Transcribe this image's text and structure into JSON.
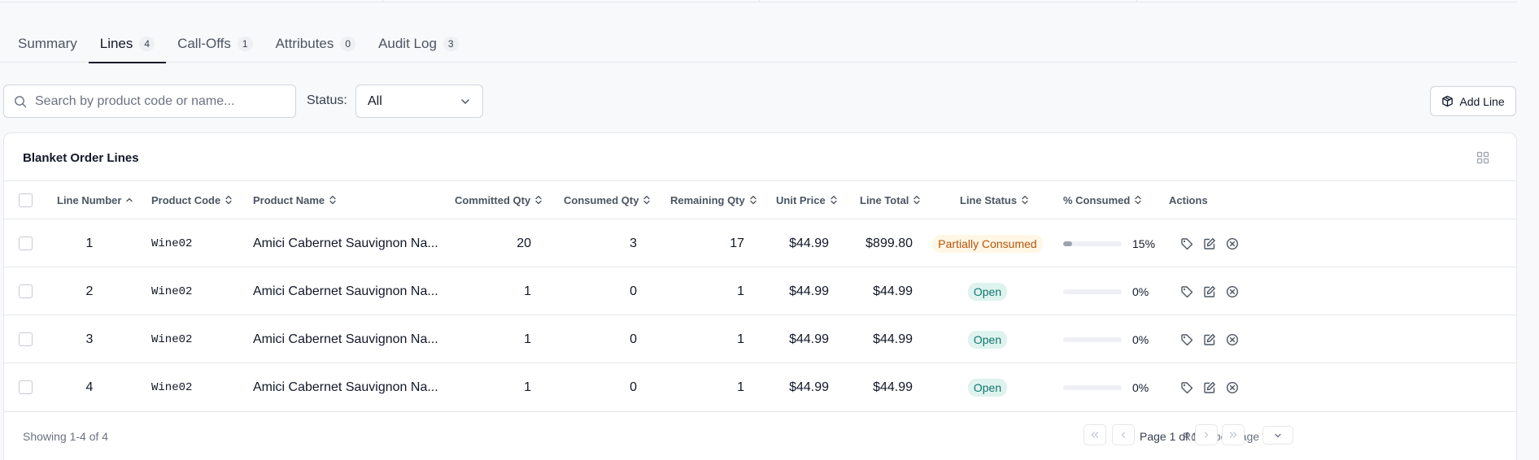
{
  "tabs": [
    {
      "label": "Summary",
      "count": ""
    },
    {
      "label": "Lines",
      "count": "4"
    },
    {
      "label": "Call-Offs",
      "count": "1"
    },
    {
      "label": "Attributes",
      "count": "0"
    },
    {
      "label": "Audit Log",
      "count": "3"
    }
  ],
  "active_tab": "Lines",
  "toolbar": {
    "search_placeholder": "Search by product code or name...",
    "status_label": "Status:",
    "status_value": "All",
    "add_line_label": "Add Line"
  },
  "table": {
    "title": "Blanket Order Lines",
    "headers": {
      "line_number": "Line Number",
      "product_code": "Product Code",
      "product_name": "Product Name",
      "committed_qty": "Committed Qty",
      "consumed_qty": "Consumed Qty",
      "remaining_qty": "Remaining Qty",
      "unit_price": "Unit Price",
      "line_total": "Line Total",
      "line_status": "Line Status",
      "pct_consumed": "% Consumed",
      "actions": "Actions"
    },
    "rows": [
      {
        "line_number": "1",
        "product_code": "Wine02",
        "product_name": "Amici Cabernet Sauvignon Na...",
        "committed_qty": "20",
        "consumed_qty": "3",
        "remaining_qty": "17",
        "unit_price": "$44.99",
        "line_total": "$899.80",
        "status": "Partially Consumed",
        "status_kind": "partial",
        "pct_consumed": "15%",
        "pct_value": 15
      },
      {
        "line_number": "2",
        "product_code": "Wine02",
        "product_name": "Amici Cabernet Sauvignon Na...",
        "committed_qty": "1",
        "consumed_qty": "0",
        "remaining_qty": "1",
        "unit_price": "$44.99",
        "line_total": "$44.99",
        "status": "Open",
        "status_kind": "open",
        "pct_consumed": "0%",
        "pct_value": 0
      },
      {
        "line_number": "3",
        "product_code": "Wine02",
        "product_name": "Amici Cabernet Sauvignon Na...",
        "committed_qty": "1",
        "consumed_qty": "0",
        "remaining_qty": "1",
        "unit_price": "$44.99",
        "line_total": "$44.99",
        "status": "Open",
        "status_kind": "open",
        "pct_consumed": "0%",
        "pct_value": 0
      },
      {
        "line_number": "4",
        "product_code": "Wine02",
        "product_name": "Amici Cabernet Sauvignon Na...",
        "committed_qty": "1",
        "consumed_qty": "0",
        "remaining_qty": "1",
        "unit_price": "$44.99",
        "line_total": "$44.99",
        "status": "Open",
        "status_kind": "open",
        "pct_consumed": "0%",
        "pct_value": 0
      }
    ]
  },
  "footer": {
    "showing": "Showing 1-4 of 4",
    "rows_per_page_label": "Rows per page",
    "page_info": "Page 1 of 1"
  },
  "icons": {
    "search": "search-icon",
    "dropdown": "chevron-down-icon",
    "add_line": "package-icon",
    "layout": "grid-icon",
    "sort_active": "chevron-up-icon",
    "sort": "sort-icon",
    "row_actions": [
      "tag-icon",
      "edit-icon",
      "cancel-icon"
    ],
    "pagination": [
      "first-page-icon",
      "prev-page-icon",
      "next-page-icon",
      "last-page-icon"
    ]
  },
  "colors": {
    "partial_bg": "#fff6e5",
    "partial_text": "#b45309",
    "open_bg": "#dff3ee",
    "open_text": "#0f766e",
    "progress_fill": "#9ca3af"
  }
}
